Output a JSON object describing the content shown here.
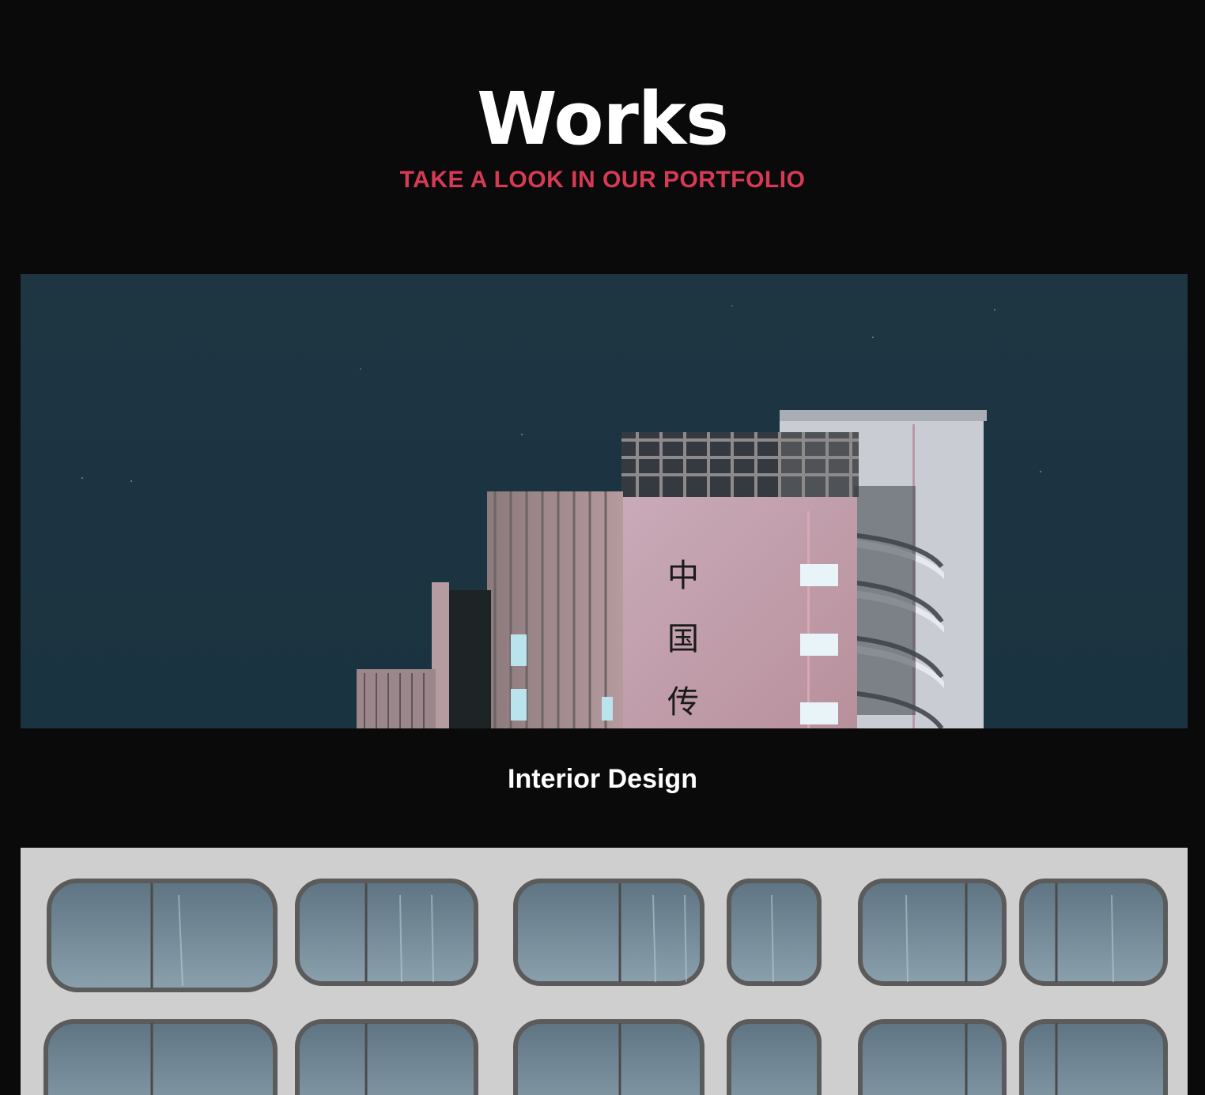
{
  "section": {
    "title": "Works",
    "subtitle": "TAKE A LOOK IN OUR PORTFOLIO"
  },
  "portfolio": {
    "items": [
      {
        "caption": "Interior Design"
      },
      {
        "caption": ""
      }
    ]
  },
  "colors": {
    "background": "#0a0a0a",
    "accent": "#d63a55",
    "heading": "#ffffff"
  }
}
